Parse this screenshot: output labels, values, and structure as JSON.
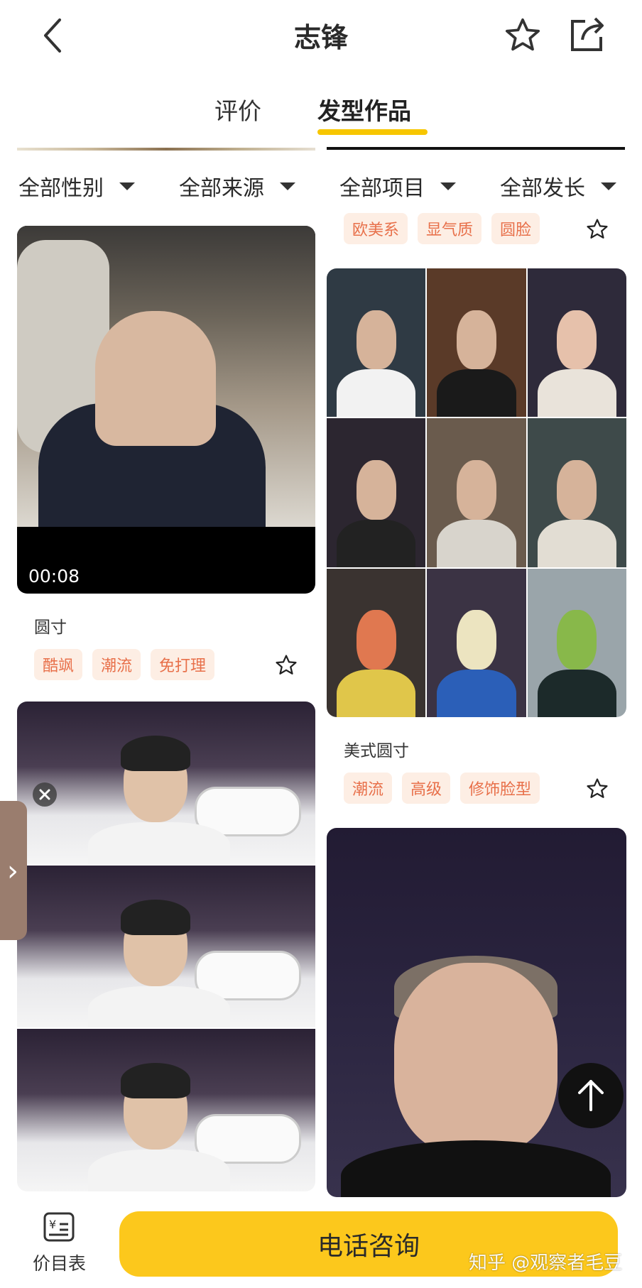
{
  "header": {
    "title": "志锋"
  },
  "tabs": [
    {
      "label": "评价"
    },
    {
      "label": "发型作品"
    }
  ],
  "filters": [
    {
      "label": "全部性别"
    },
    {
      "label": "全部来源"
    },
    {
      "label": "全部项目"
    },
    {
      "label": "全部发长"
    }
  ],
  "feed_left": [
    {
      "type": "video",
      "duration": "00:08",
      "title": "圆寸",
      "tags": [
        "酷飒",
        "潮流",
        "免打理"
      ]
    },
    {
      "type": "photo-stack",
      "title": "",
      "tags": []
    }
  ],
  "feed_right": [
    {
      "type": "partial-top",
      "tags": [
        "欧美系",
        "显气质",
        "圆脸"
      ]
    },
    {
      "type": "photo-grid",
      "title": "美式圆寸",
      "tags": [
        "潮流",
        "高级",
        "修饰脸型"
      ]
    },
    {
      "type": "photo",
      "title": "",
      "tags": []
    }
  ],
  "bottom_bar": {
    "price_label": "价目表",
    "call_label": "电话咨询"
  },
  "watermark": "知乎 @观察者毛豆",
  "colors": {
    "accent": "#fcc81c",
    "tag_bg": "#fdeee4",
    "tag_text": "#e8704a",
    "side_tab": "#9a7d6e"
  }
}
